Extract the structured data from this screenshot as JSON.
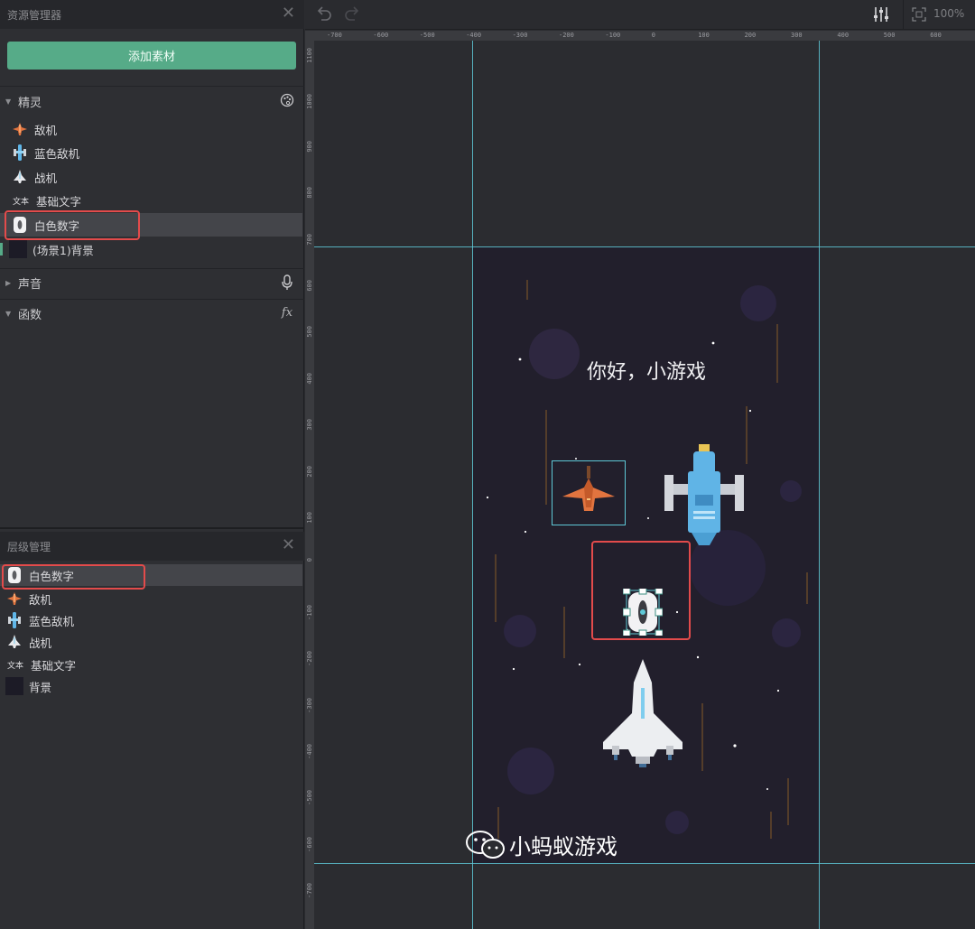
{
  "asset_panel": {
    "title": "资源管理器",
    "add_button": "添加素材",
    "sections": {
      "sprites": "精灵",
      "sounds": "声音",
      "functions": "函数"
    },
    "sprites": [
      {
        "label": "敌机",
        "icon": "orange-jet-icon"
      },
      {
        "label": "蓝色敌机",
        "icon": "blue-ship-icon"
      },
      {
        "label": "战机",
        "icon": "white-fighter-icon"
      },
      {
        "label": "基础文字",
        "icon": "text-icon"
      },
      {
        "label": "白色数字",
        "icon": "digit-zero-icon",
        "selected": true
      },
      {
        "label": "(场景1)背景",
        "icon": "background-thumb-icon"
      }
    ],
    "text_icon_glyph": "文本",
    "fx_glyph": "fx"
  },
  "layer_panel": {
    "title": "层级管理",
    "layers": [
      {
        "label": "白色数字",
        "icon": "digit-zero-icon",
        "selected": true
      },
      {
        "label": "敌机",
        "icon": "orange-jet-icon"
      },
      {
        "label": "蓝色敌机",
        "icon": "blue-ship-icon"
      },
      {
        "label": "战机",
        "icon": "white-fighter-icon"
      },
      {
        "label": "基础文字",
        "icon": "text-icon"
      },
      {
        "label": "背景",
        "icon": "background-thumb-icon"
      }
    ]
  },
  "toolbar": {
    "zoom": "100%"
  },
  "rulers": {
    "horizontal": [
      "-700",
      "-600",
      "-500",
      "-400",
      "-300",
      "-200",
      "-100",
      "0",
      "100",
      "200",
      "300",
      "400",
      "500",
      "600"
    ],
    "vertical": [
      "1100",
      "1000",
      "900",
      "800",
      "700",
      "600",
      "500",
      "400",
      "300",
      "200",
      "100",
      "0",
      "-100",
      "-200",
      "-300",
      "-400",
      "-500",
      "-600",
      "-700"
    ]
  },
  "stage": {
    "greeting": "你好，小游戏",
    "digit": "0"
  },
  "watermark": {
    "text": "小蚂蚁游戏"
  },
  "colors": {
    "accent_green": "#56ab88",
    "highlight_red": "#e34b4b",
    "guide_cyan": "#5ec8d6",
    "stage_bg": "#221f2c"
  }
}
